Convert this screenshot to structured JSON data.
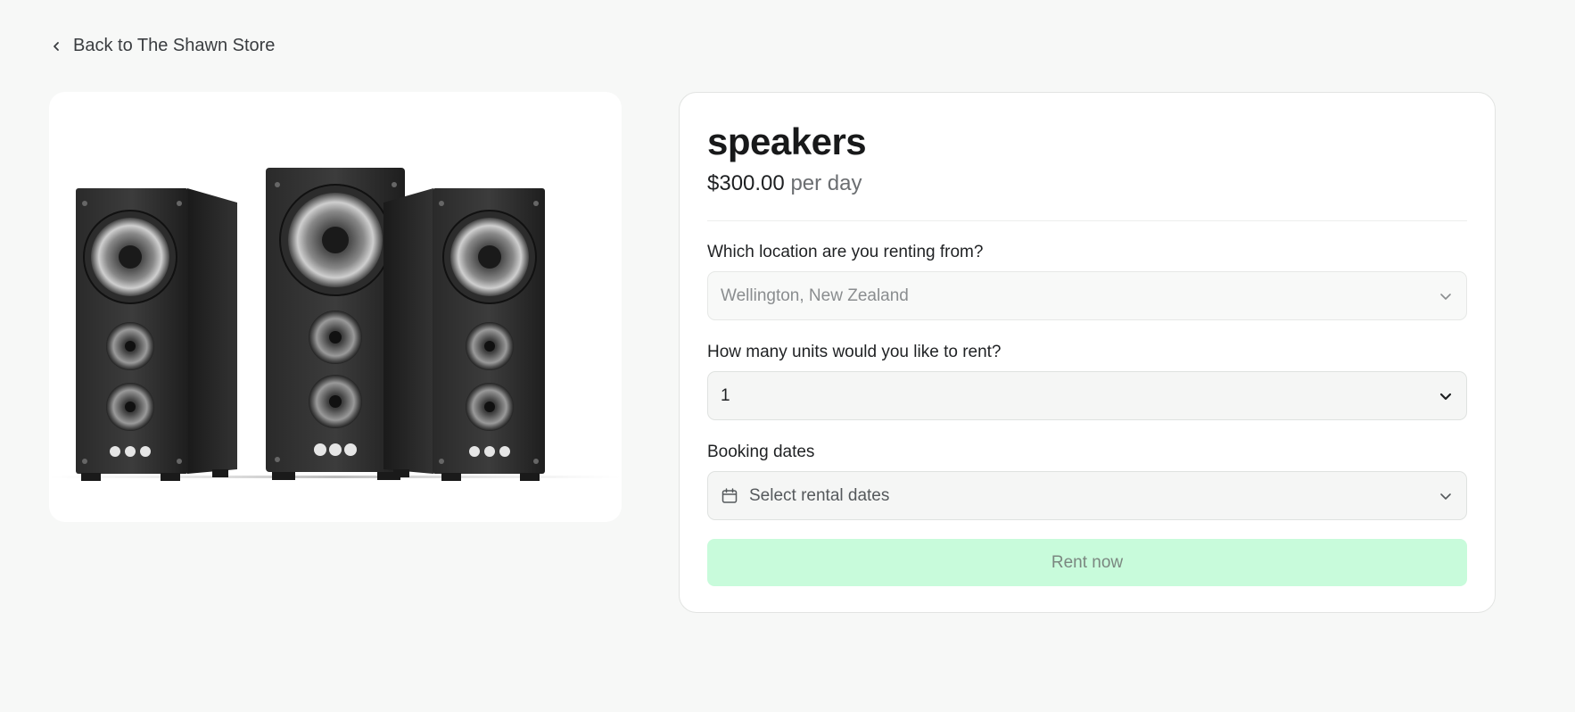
{
  "nav": {
    "back_label": "Back to The Shawn Store"
  },
  "product": {
    "name": "speakers",
    "price": "$300.00",
    "price_unit": "per day",
    "image_alt": "three black speakers"
  },
  "form": {
    "location": {
      "label": "Which location are you renting from?",
      "value": "Wellington, New Zealand"
    },
    "units": {
      "label": "How many units would you like to rent?",
      "value": "1"
    },
    "dates": {
      "label": "Booking dates",
      "placeholder": "Select rental dates"
    },
    "submit_label": "Rent now"
  },
  "colors": {
    "page_background": "#f7f8f7",
    "card_background": "#ffffff",
    "button_background": "#c8fbdb",
    "button_text": "#7b8780"
  },
  "icons": {
    "back": "chevron-left-icon",
    "location_arrow": "chevron-down-icon",
    "units_arrow": "chevron-down-icon",
    "dates_calendar": "calendar-icon",
    "dates_arrow": "chevron-down-icon"
  }
}
